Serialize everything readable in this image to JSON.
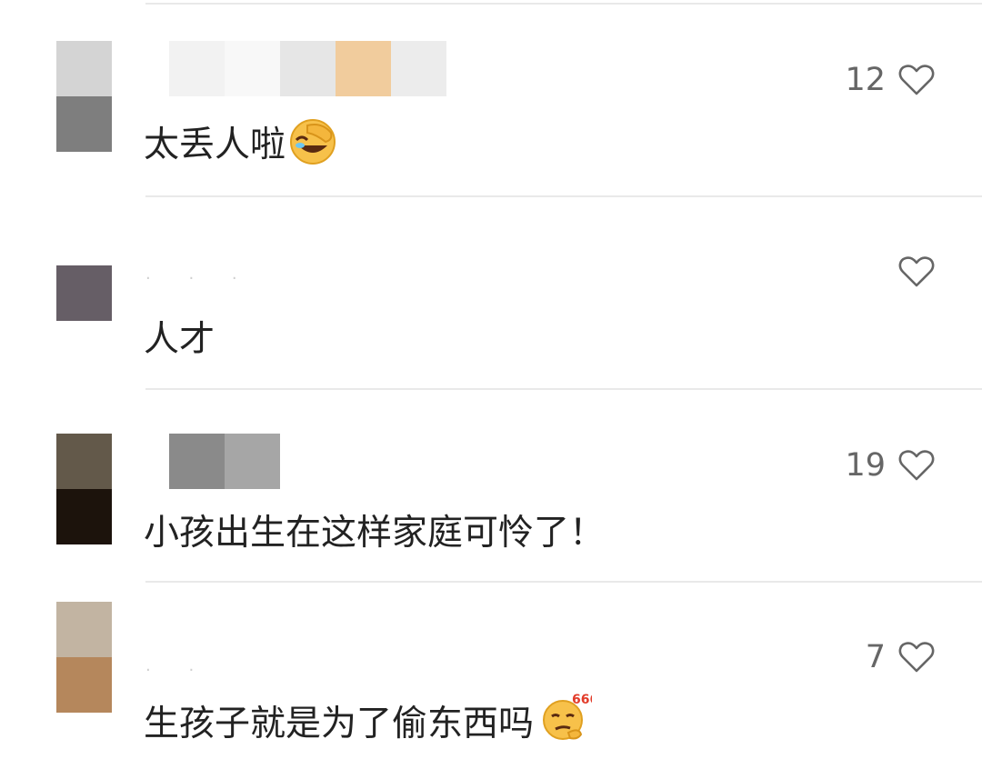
{
  "comments": [
    {
      "text": "太丢人啦",
      "likes": "12",
      "emoji": "facepalm-laughing-emoji",
      "avatar_colors": [
        "#d4d4d4",
        "#7e7e7e"
      ],
      "name_blur_colors": [
        "#f2f2f2",
        "#f8f8f8",
        "#e6e6e6",
        "#f1cc9d",
        "#ececec"
      ]
    },
    {
      "text": "人才",
      "likes": "",
      "emoji": "",
      "avatar_colors": [
        "#665e66"
      ],
      "name_faint": "· · ·"
    },
    {
      "text": "小孩出生在这样家庭可怜了！",
      "likes": "19",
      "emoji": "",
      "avatar_colors": [
        "#63594a",
        "#1c130c"
      ],
      "name_blur_colors": [
        "#8a8a8a",
        "#a6a6a6"
      ]
    },
    {
      "text": "生孩子就是为了偷东西吗",
      "likes": "7",
      "emoji": "thinking-666-emoji",
      "emoji_text": "666",
      "avatar_colors": [
        "#c2b4a2",
        "#b5875c"
      ],
      "name_faint": "· ·"
    }
  ],
  "colors": {
    "text": "#222222",
    "like_count": "#666666",
    "heart_stroke": "#666666",
    "divider": "#e9e9e9"
  }
}
